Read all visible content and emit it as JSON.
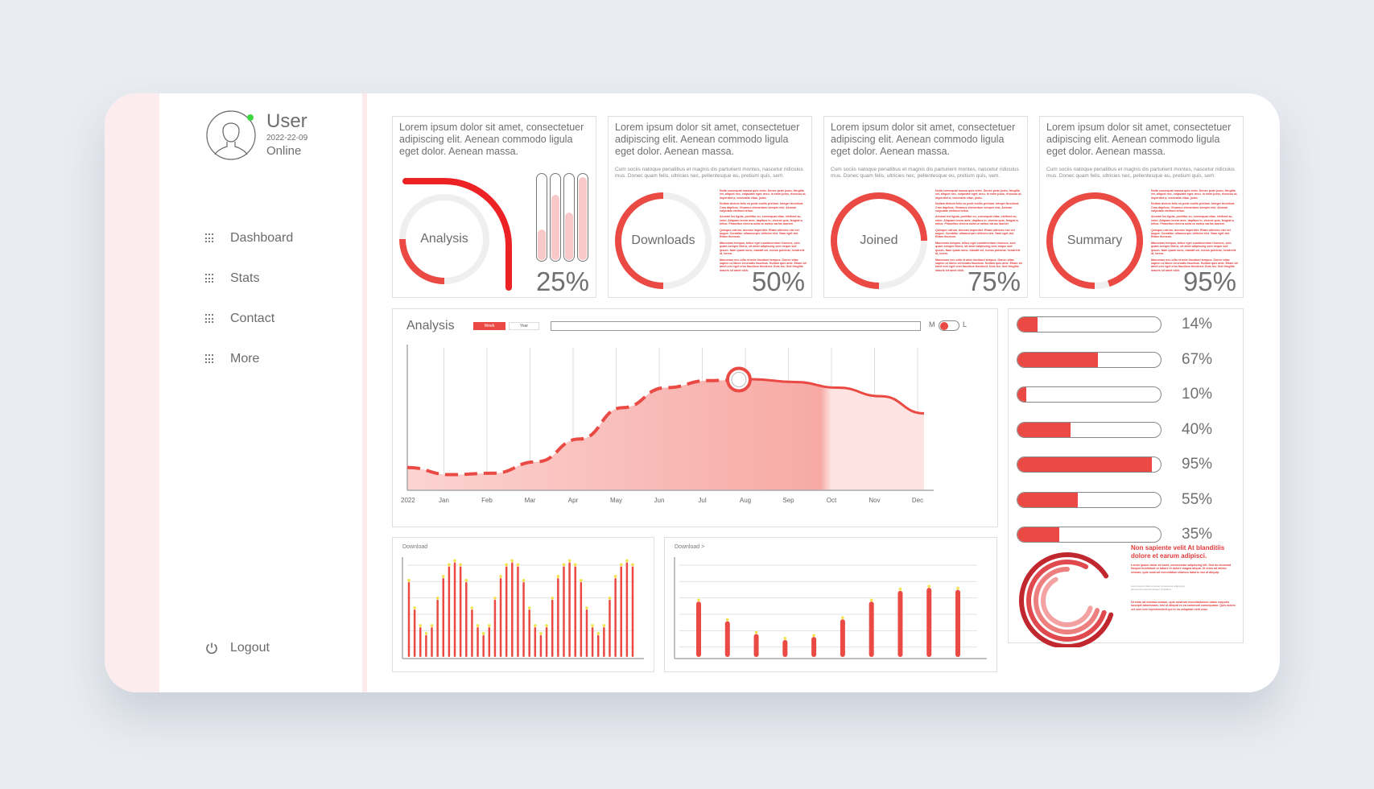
{
  "user": {
    "name": "User",
    "date": "2022-22-09",
    "status": "Online"
  },
  "sidebar": {
    "items": [
      {
        "label": "Dashboard",
        "icon": "grid-icon"
      },
      {
        "label": "Stats",
        "icon": "grid-icon"
      },
      {
        "label": "Contact",
        "icon": "grid-icon"
      },
      {
        "label": "More",
        "icon": "grid-icon"
      }
    ],
    "logout": {
      "label": "Logout",
      "icon": "power-icon"
    }
  },
  "colors": {
    "accent": "#ea4a43",
    "accent_light": "#f9c9c9",
    "online": "#3ed63e"
  },
  "cards": [
    {
      "title": "Lorem ipsum dolor sit amet, consectetuer adipiscing elit. Aenean commodo ligula eget dolor. Aenean massa.",
      "label": "Analysis",
      "percent": "25%",
      "value": 25,
      "tubes": [
        0.35,
        0.75,
        0.55,
        0.95
      ]
    },
    {
      "title": "Lorem ipsum dolor sit amet, consectetuer adipiscing elit. Aenean commodo ligula eget dolor. Aenean massa.",
      "subtitle": "Cum sociis natoque penatibus et magnis dis parturient montes, nascetur ridiculus mus. Donec quam felis, ultricies nec, pellentesque eu, pretium quis, sem.",
      "label": "Downloads",
      "percent": "50%",
      "value": 50
    },
    {
      "title": "Lorem ipsum dolor sit amet, consectetuer adipiscing elit. Aenean commodo ligula eget dolor. Aenean massa.",
      "subtitle": "Cum sociis natoque penatibus et magnis dis parturient montes, nascetur ridiculus mus. Donec quam felis, ultricies nec, pellentesque eu, pretium quis, sem.",
      "label": "Joined",
      "percent": "75%",
      "value": 75
    },
    {
      "title": "Lorem ipsum dolor sit amet, consectetuer adipiscing elit. Aenean commodo ligula eget dolor. Aenean massa.",
      "subtitle": "Cum sociis natoque penatibus et magnis dis parturient montes, nascetur ridiculus mus. Donec quam felis, ultricies nec, pellentesque eu, pretium quis, sem.",
      "label": "Summary",
      "percent": "95%",
      "value": 95
    }
  ],
  "red_text": [
    "Nulla consequat massa quis enim. Donec pede justo, fringilla vel, aliquet nec, vulputate eget, arcu. In enim justo, rhoncus ut, imperdiet a, venenatis vitae, justo.",
    "Nullam dictum felis eu pede mollis pretium. Integer tincidunt. Cras dapibus. Vivamus elementum semper nisi. Aenean vulputate eleifend tellus.",
    "Aenean leo ligula, porttitor eu, consequat vitae, eleifend ac, enim. Aliquam lorem ante, dapibus in, viverra quis, feugiat a, tellus. Phasellus viverra nulla ut metus varius laoreet.",
    "Quisque rutrum. Aenean imperdiet. Etiam ultricies nisi vel augue. Curabitur ullamcorper ultricies nisi. Nam eget dui. Etiam rhoncus.",
    "Maecenas tempus, tellus eget condimentum rhoncus, sem quam semper libero, sit amet adipiscing sem neque sed ipsum. Nam quam nunc, blandit vel, luctus pulvinar, hendrerit id, lorem.",
    "Maecenas nec odio et ante tincidunt tempus. Donec vitae sapien ut libero venenatis faucibus. Nullam quis ante. Etiam sit amet orci eget eros faucibus tincidunt. Duis leo. Sed fringilla mauris sit amet nibh."
  ],
  "analysis": {
    "title": "Analysis",
    "segments": [
      "Week",
      "Year"
    ],
    "toggle_left": "M",
    "toggle_right": "L",
    "x_labels": [
      "2022",
      "Jan",
      "Feb",
      "Mar",
      "Apr",
      "May",
      "Jun",
      "Jul",
      "Aug",
      "Sep",
      "Oct",
      "Nov",
      "Dec"
    ],
    "series": [
      0.16,
      0.11,
      0.12,
      0.2,
      0.36,
      0.58,
      0.72,
      0.77,
      0.78,
      0.76,
      0.72,
      0.66,
      0.54
    ],
    "highlight_index": 7.7
  },
  "progress": [
    {
      "label": "14%",
      "value": 0.14
    },
    {
      "label": "67%",
      "value": 0.56
    },
    {
      "label": "10%",
      "value": 0.06
    },
    {
      "label": "40%",
      "value": 0.37
    },
    {
      "label": "95%",
      "value": 0.94
    },
    {
      "label": "55%",
      "value": 0.42
    },
    {
      "label": "35%",
      "value": 0.29
    }
  ],
  "radial": {
    "heading": "Non sapiente velit At blanditiis dolore et earum adipisci.",
    "body": "Lorem ipsum dolor sit amet, consectetur adipiscing elit. Sed do eiusmod tempor incididunt ut labore et dolore magna aliqua. Ut enim ad minim veniam, quis nostrud exercitation ullamco laboris nisi ut aliquip.",
    "gray": "Lorem ipsum dolor sit amet consectetur adipiscing elit sed do eiusmod tempor incididunt.",
    "body2": "Ut enim ad minima veniam, quis nostrum exercitationem ullam corporis suscipit laboriosam, nisi ut aliquid ex ea commodi consequatur. Quis autem vel eum iure reprehenderit qui in ea voluptate velit esse.",
    "rings": [
      0.62,
      0.7,
      0.78,
      0.86
    ]
  },
  "download1": {
    "title": "Download",
    "values": [
      0.78,
      0.5,
      0.32,
      0.24,
      0.32,
      0.6,
      0.82,
      0.94,
      0.98,
      0.94,
      0.78,
      0.5,
      0.32,
      0.24,
      0.32,
      0.6,
      0.82,
      0.94,
      0.98,
      0.94,
      0.78,
      0.5,
      0.32,
      0.24,
      0.32,
      0.6,
      0.82,
      0.94,
      0.98,
      0.94,
      0.78,
      0.5,
      0.32,
      0.24,
      0.32,
      0.6,
      0.82,
      0.94,
      0.98,
      0.94
    ]
  },
  "download2": {
    "title": "Download >",
    "values": [
      0.58,
      0.38,
      0.25,
      0.19,
      0.22,
      0.4,
      0.58,
      0.69,
      0.72,
      0.7
    ]
  }
}
